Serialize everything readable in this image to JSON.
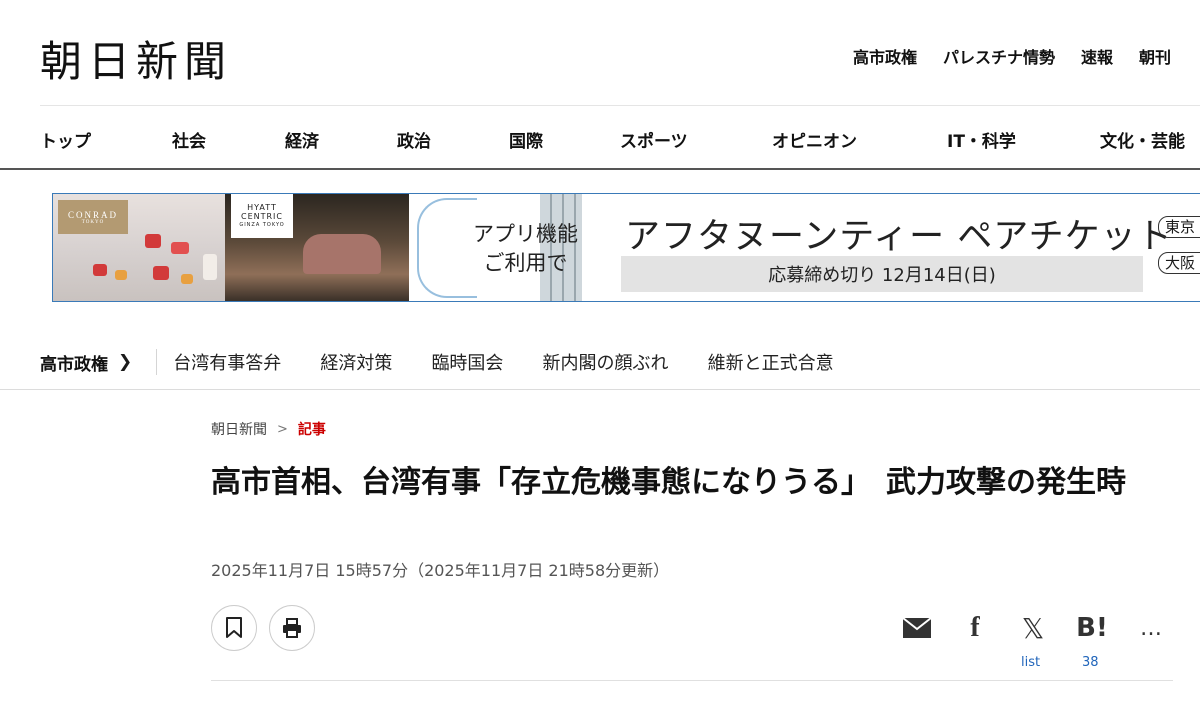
{
  "header": {
    "logo": "朝日新聞",
    "top_links": [
      "高市政権",
      "パレスチナ情勢",
      "速報",
      "朝刊"
    ]
  },
  "nav": {
    "items": [
      "トップ",
      "社会",
      "経済",
      "政治",
      "国際",
      "スポーツ",
      "オピニオン",
      "IT・科学",
      "文化・芸能"
    ]
  },
  "banner": {
    "conrad": "CONRAD",
    "conrad_sub": "TOKYO",
    "hyatt_line1": "HYATT",
    "hyatt_line2": "CENTRIC",
    "hyatt_sub": "GINZA TOKYO",
    "app_line1": "アプリ機能",
    "app_line2": "ご利用で",
    "headline": "アフタヌーンティー ペアチケット",
    "deadline": "応募締め切り 12月14日(日)",
    "city1": "東京",
    "city2": "大阪"
  },
  "topic_bar": {
    "main": "高市政権",
    "links": [
      "台湾有事答弁",
      "経済対策",
      "臨時国会",
      "新内閣の顔ぶれ",
      "維新と正式合意"
    ]
  },
  "breadcrumb": {
    "home": "朝日新聞",
    "separator": ">",
    "current": "記事"
  },
  "article": {
    "title": "高市首相、台湾有事「存立危機事態になりうる」　武力攻撃の発生時",
    "dateline": "2025年11月7日 15時57分（2025年11月7日 21時58分更新）"
  },
  "share": {
    "x_label": "list",
    "hatena_label": "B!",
    "hatena_count": "38",
    "facebook_label": "f",
    "x_symbol": "𝕏",
    "more_label": "…"
  }
}
